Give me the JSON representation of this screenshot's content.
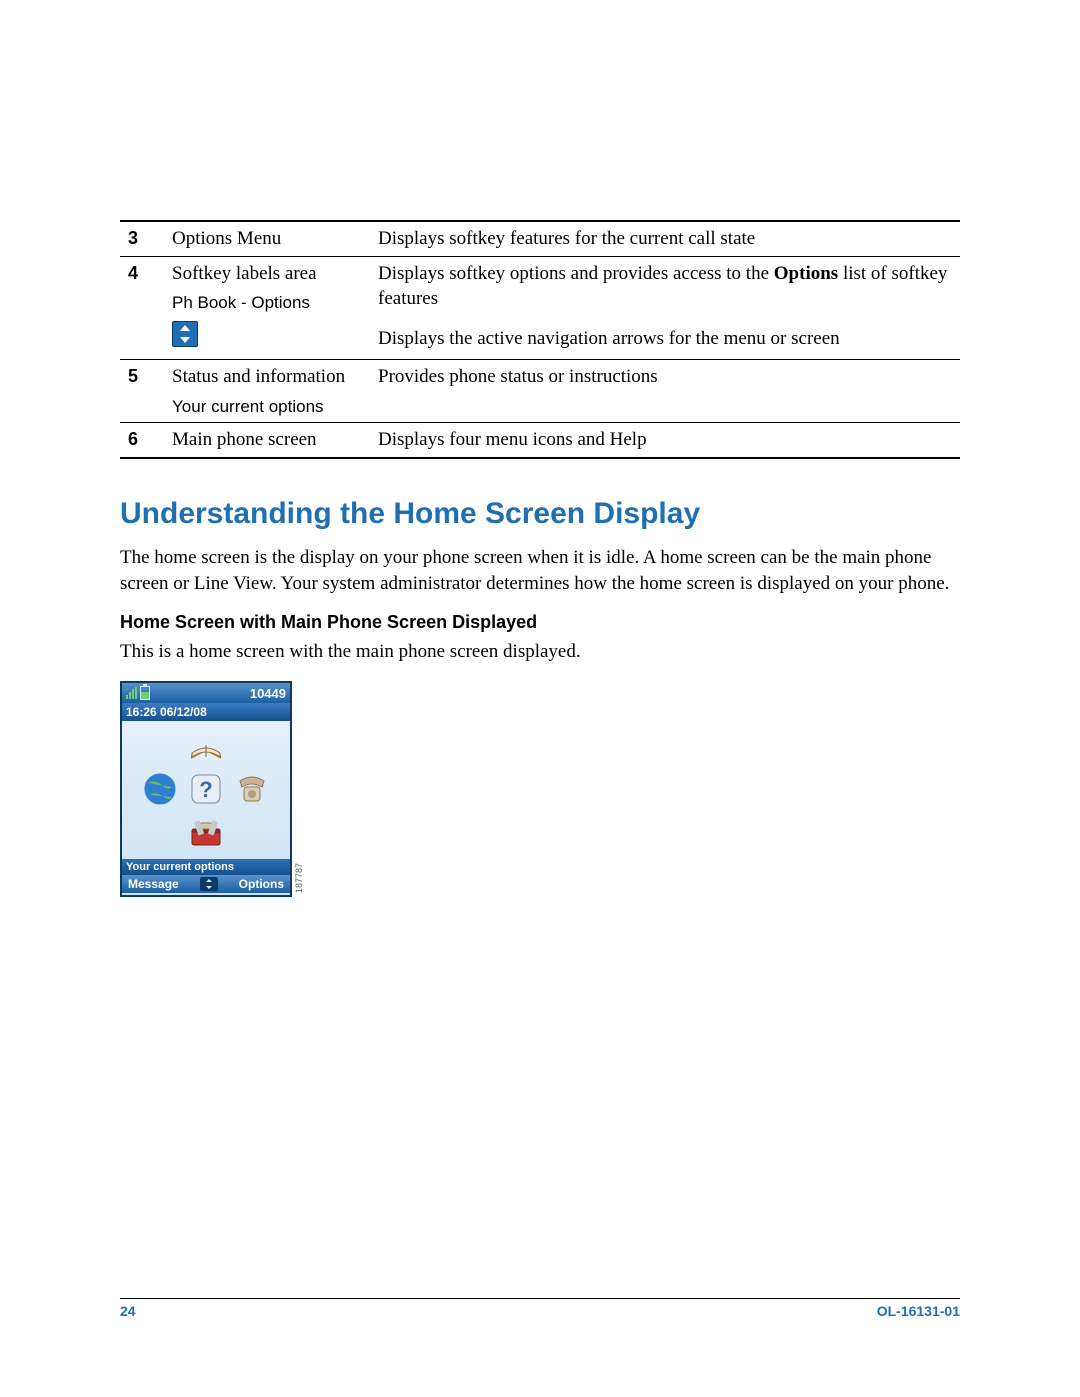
{
  "table": {
    "rows": [
      {
        "num": "3",
        "name": "Options Menu",
        "desc": "Displays softkey features for the current call state"
      },
      {
        "num": "4",
        "name": "Softkey labels area",
        "sub": "Ph Book - Options",
        "desc_pre": "Displays softkey options and provides access to the ",
        "desc_bold": "Options",
        "desc_post": " list of softkey features",
        "desc2": "Displays the active navigation arrows for the menu or screen"
      },
      {
        "num": "5",
        "name": "Status and information",
        "sub": "Your current options",
        "desc": "Provides phone status or instructions"
      },
      {
        "num": "6",
        "name": "Main phone screen",
        "desc": "Displays four menu icons and Help"
      }
    ]
  },
  "section_title": "Understanding the Home Screen Display",
  "para1": "The home screen is the display on your phone screen when it is idle. A home screen can be the main phone screen or Line View. Your system administrator determines how the home screen is displayed on your phone.",
  "subhead": "Home Screen with Main Phone Screen Displayed",
  "para2": "This is a home screen with the main phone screen displayed.",
  "phone": {
    "number": "10449",
    "datetime": "16:26 06/12/08",
    "status": "Your current options",
    "soft_left": "Message",
    "soft_right": "Options",
    "image_id": "187787"
  },
  "footer": {
    "page": "24",
    "docid": "OL-16131-01"
  }
}
